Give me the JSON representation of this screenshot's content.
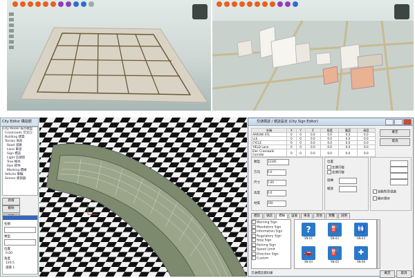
{
  "top_left_view": {
    "toolbar_icons": [
      "orange-tool-icon",
      "orange-tool-icon",
      "orange-tool-icon",
      "orange-tool-icon",
      "orange-tool-icon",
      "orange-tool-icon",
      "purple-tool-icon",
      "purple-tool-icon",
      "blue-tool-icon",
      "blue-tool-icon",
      "view-icon",
      "view-icon"
    ],
    "ground_color": "#d9d3c6",
    "grid_line_color": "#6b5a32"
  },
  "top_right_view": {
    "toolbar_icons": [
      "orange-tool-icon",
      "orange-tool-icon",
      "orange-tool-icon",
      "orange-tool-icon",
      "orange-tool-icon",
      "orange-tool-icon",
      "orange-tool-icon",
      "orange-tool-icon",
      "purple-tool-icon",
      "purple-tool-icon",
      "blue-tool-icon",
      "view-icon",
      "view-icon"
    ],
    "building_colors": [
      "#f2efe9",
      "#e8b293",
      "#f7f5f0"
    ]
  },
  "tree_panel": {
    "title": "City Editor 構造樹",
    "items": [
      "City Model 城市模型",
      "Crossroads 交叉口",
      "Building 建築",
      "Terrain 地形",
      "Road 道路",
      "Lane 車道",
      "Sign 標誌",
      "Light 信號燈",
      "Tree 樹木",
      "Pole 桿件",
      "Marking 標線",
      "Vehicle 車輛",
      "Sensor 感測器"
    ],
    "buttons": [
      "新增",
      "刪除",
      "編輯",
      "複製"
    ],
    "fields": [
      "名稱",
      "類型",
      "位置",
      "角度"
    ],
    "bottom_values": [
      "0.00",
      "120.5",
      "道路 1"
    ]
  },
  "dialog": {
    "title": "交通標誌 / 號誌設定 (City Sign Editor)",
    "table": {
      "headers": [
        "名稱",
        "X",
        "Y",
        "Z",
        "角度",
        "寬度",
        "高度"
      ],
      "rows": [
        [
          "ARROW STL",
          "0",
          "0",
          "0.0",
          "0.0",
          "0.0",
          "0.0"
        ],
        [
          "LLS",
          "0",
          "0",
          "0.0",
          "0.0",
          "0.0",
          "0.0"
        ],
        [
          "CYCLE",
          "0",
          "0",
          "0.0",
          "0.0",
          "0.0",
          "0.0"
        ],
        [
          "YIELD Lane",
          "0",
          "0",
          "0.0",
          "0.0",
          "0.0",
          "0.0"
        ],
        [
          "Elec Crosswalk Corridor",
          "0",
          "0",
          "0.0",
          "0.0",
          "0.0",
          "0.0"
        ]
      ]
    },
    "labels": [
      "類型",
      "方向",
      "尺寸",
      "高度",
      "材質",
      "位置",
      "旋轉",
      "縮放"
    ],
    "input_values": [
      "12345",
      "0.0",
      "1.00",
      "0.0",
      "100"
    ],
    "options": [
      "左側行駛",
      "右側行駛",
      "自動對齊道路",
      "顯示標示"
    ],
    "tabs": [
      "標誌",
      "號誌",
      "標線",
      "設施",
      "車道",
      "其他",
      "預覽",
      "說明"
    ],
    "list_items": [
      "Warning Sign",
      "Mandatory Sign",
      "Information Sign",
      "Regulatory Sign",
      "Stop Sign",
      "Parking Sign",
      "Speed Limit",
      "Direction Sign",
      "Custom"
    ],
    "icons": [
      {
        "glyph": "?",
        "caption": "SN-01"
      },
      {
        "glyph": "⛽",
        "caption": "SN-02"
      },
      {
        "glyph": "🚻",
        "caption": "SN-03"
      },
      {
        "glyph": "🚗",
        "caption": "SN-04"
      },
      {
        "glyph": "⛽",
        "caption": "SN-05"
      },
      {
        "glyph": "✚",
        "caption": "SN-06"
      }
    ],
    "footer_text": "交通標誌資料庫",
    "ok_label": "確定",
    "cancel_label": "取消"
  }
}
